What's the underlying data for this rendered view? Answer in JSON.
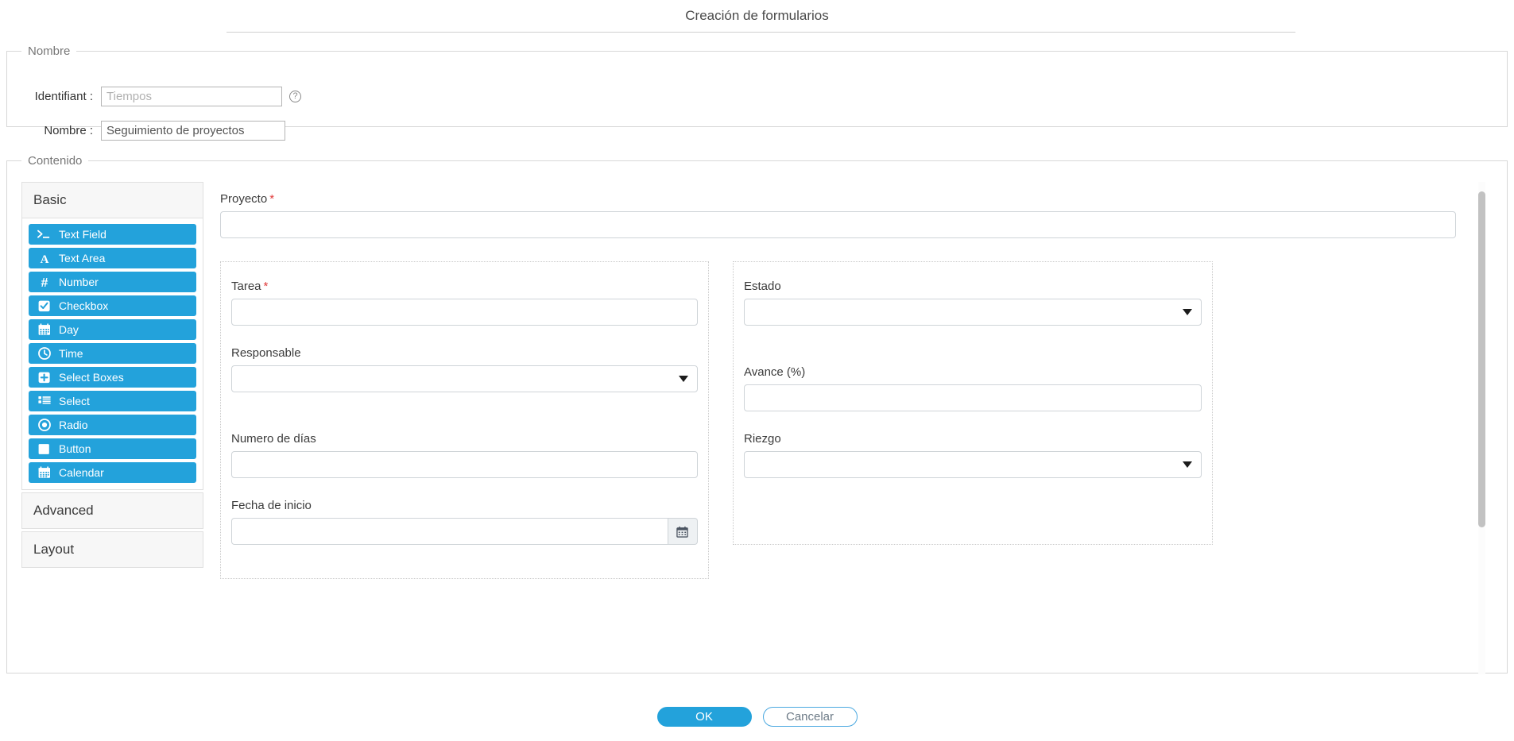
{
  "header": {
    "title": "Creación de formularios"
  },
  "name_section": {
    "legend": "Nombre",
    "identifiant_label": "Identifiant :",
    "identifiant_value": "",
    "identifiant_placeholder": "Tiempos",
    "help_icon": "help-circle-icon",
    "help_glyph": "?",
    "nombre_label": "Nombre :",
    "nombre_value": "Seguimiento de proyectos",
    "nombre_placeholder": ""
  },
  "content_section": {
    "legend": "Contenido"
  },
  "sidebar": {
    "groups": [
      {
        "label": "Basic",
        "expanded": true,
        "components": [
          {
            "label": "Text Field",
            "icon": "terminal-icon"
          },
          {
            "label": "Text Area",
            "icon": "font-letter-a-icon"
          },
          {
            "label": "Number",
            "icon": "hash-icon"
          },
          {
            "label": "Checkbox",
            "icon": "checkbox-checked-icon"
          },
          {
            "label": "Day",
            "icon": "calendar-icon"
          },
          {
            "label": "Time",
            "icon": "clock-icon"
          },
          {
            "label": "Select Boxes",
            "icon": "plus-square-icon"
          },
          {
            "label": "Select",
            "icon": "list-icon"
          },
          {
            "label": "Radio",
            "icon": "radio-dot-icon"
          },
          {
            "label": "Button",
            "icon": "square-icon"
          },
          {
            "label": "Calendar",
            "icon": "calendar-icon"
          }
        ]
      },
      {
        "label": "Advanced",
        "expanded": false,
        "components": []
      },
      {
        "label": "Layout",
        "expanded": false,
        "components": []
      }
    ]
  },
  "form": {
    "proyecto": {
      "label": "Proyecto",
      "required": true,
      "required_mark": "*",
      "value": "",
      "placeholder": "",
      "type": "textfield"
    },
    "left_column": [
      {
        "label": "Tarea",
        "required": true,
        "required_mark": "*",
        "value": "",
        "placeholder": "",
        "type": "textfield"
      },
      {
        "label": "Responsable",
        "required": false,
        "required_mark": "",
        "value": "",
        "placeholder": "",
        "type": "select",
        "selected_option": ""
      },
      {
        "label": "Numero de días",
        "required": false,
        "required_mark": "",
        "value": "",
        "placeholder": "",
        "type": "number"
      },
      {
        "label": "Fecha de inicio",
        "required": false,
        "required_mark": "",
        "value": "",
        "placeholder": "",
        "type": "date",
        "button_icon": "calendar-icon"
      }
    ],
    "right_column": [
      {
        "label": "Estado",
        "required": false,
        "required_mark": "",
        "value": "",
        "placeholder": "",
        "type": "select",
        "selected_option": ""
      },
      {
        "label": "Avance (%)",
        "required": false,
        "required_mark": "",
        "value": "",
        "placeholder": "",
        "type": "number"
      },
      {
        "label": "Riezgo",
        "required": false,
        "required_mark": "",
        "value": "",
        "placeholder": "",
        "type": "select",
        "selected_option": ""
      }
    ]
  },
  "footer": {
    "ok_label": "OK",
    "cancel_label": "Cancelar"
  },
  "colors": {
    "accent": "#23a2db",
    "required": "#e03a3a",
    "panel_border": "#d7d7d7",
    "dotted_border": "#c9c9c9",
    "input_border": "#cfd4d8",
    "scrollbar_thumb": "#c2c2c2"
  }
}
